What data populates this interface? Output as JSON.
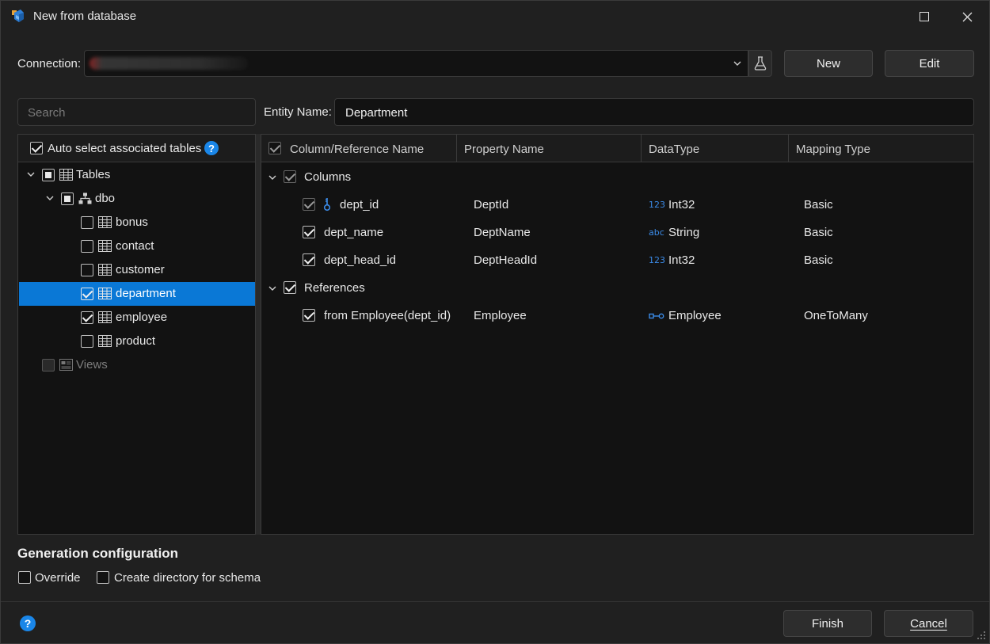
{
  "window": {
    "title": "New from database",
    "maximize_icon": "maximize-icon",
    "close_icon": "close-icon"
  },
  "connection": {
    "label": "Connection:",
    "value": "",
    "test_icon": "flask-icon",
    "new_label": "New",
    "edit_label": "Edit"
  },
  "search": {
    "placeholder": "Search"
  },
  "entity": {
    "label": "Entity Name:",
    "value": "Department"
  },
  "tree": {
    "auto_select_label": "Auto select associated tables",
    "auto_select_checked": true,
    "nodes": [
      {
        "label": "Tables",
        "state": "partial"
      },
      {
        "label": "dbo",
        "state": "partial"
      },
      {
        "label": "bonus",
        "state": "unchecked"
      },
      {
        "label": "contact",
        "state": "unchecked"
      },
      {
        "label": "customer",
        "state": "unchecked"
      },
      {
        "label": "department",
        "state": "checked",
        "selected": true
      },
      {
        "label": "employee",
        "state": "checked"
      },
      {
        "label": "product",
        "state": "unchecked"
      },
      {
        "label": "Views",
        "state": "disabled"
      }
    ]
  },
  "grid": {
    "headers": [
      "Column/Reference Name",
      "Property Name",
      "DataType",
      "Mapping Type"
    ],
    "groups": [
      {
        "label": "Columns"
      },
      {
        "label": "References"
      }
    ],
    "rows": [
      {
        "name": "dept_id",
        "property": "DeptId",
        "type_icon": "123",
        "type": "Int32",
        "mapping": "Basic",
        "key": true
      },
      {
        "name": "dept_name",
        "property": "DeptName",
        "type_icon": "abc",
        "type": "String",
        "mapping": "Basic"
      },
      {
        "name": "dept_head_id",
        "property": "DeptHeadId",
        "type_icon": "123",
        "type": "Int32",
        "mapping": "Basic"
      },
      {
        "name": "from Employee(dept_id)",
        "property": "Employee",
        "type_icon": "link",
        "type": "Employee",
        "mapping": "OneToMany"
      }
    ]
  },
  "generation": {
    "title": "Generation configuration",
    "override_label": "Override",
    "create_dir_label": "Create directory for schema"
  },
  "footer": {
    "finish_label": "Finish",
    "cancel_label": "Cancel"
  },
  "colors": {
    "accent": "#0a78d6",
    "help_blue": "#1a86e8",
    "type_blue": "#3b8ae6"
  }
}
